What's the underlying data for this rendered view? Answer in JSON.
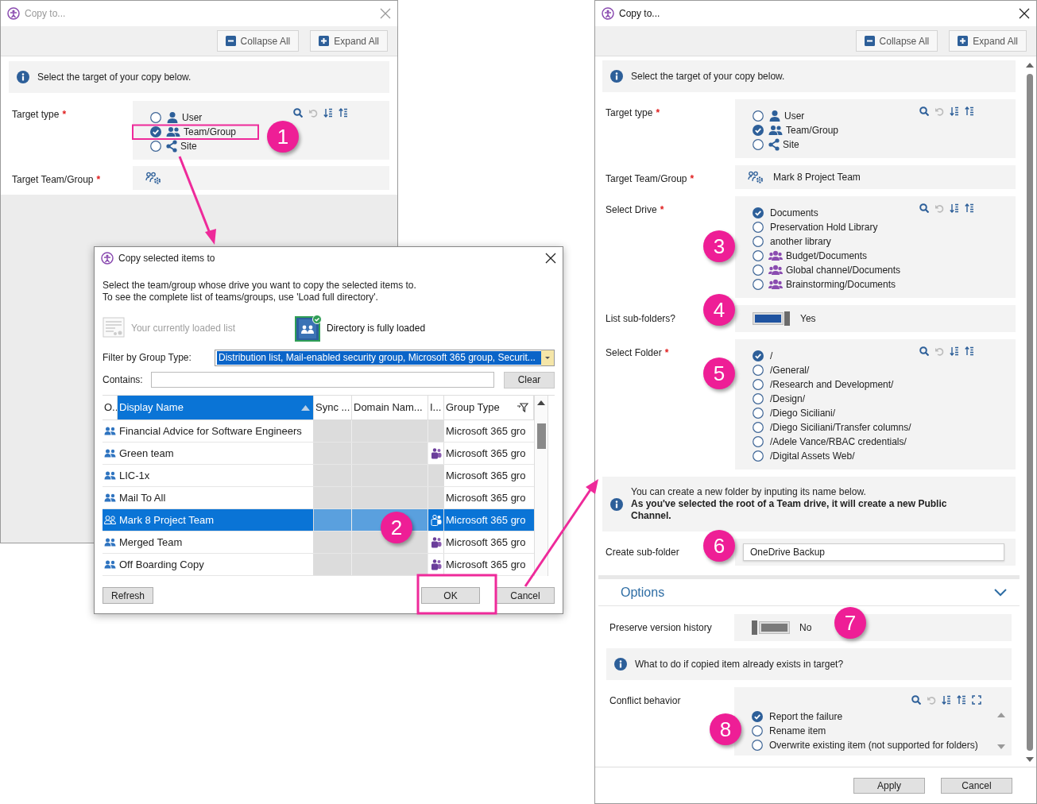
{
  "back_window": {
    "title": "Copy to...",
    "toolbar_buttons": [
      {
        "label": "Collapse All",
        "kind": "collapse"
      },
      {
        "label": "Expand All",
        "kind": "expand"
      }
    ],
    "info": "Select the target of your copy below.",
    "fields": [
      {
        "label": "Target type",
        "required_mark": "*",
        "kind": "radio",
        "options": [
          {
            "label": "User",
            "kind": "user",
            "selected": false
          },
          {
            "label": "Team/Group",
            "kind": "team",
            "selected": true
          },
          {
            "label": "Site",
            "kind": "site",
            "selected": false
          }
        ]
      },
      {
        "label": "Target Team/Group",
        "required_mark": "*",
        "kind": "picker"
      }
    ]
  },
  "dialog": {
    "title": "Copy selected items to",
    "description": "Select the team/group whose drive you want to copy the selected items to.\nTo see the complete list of teams/groups, use 'Load full directory'.",
    "sources": [
      {
        "label": "Your currently loaded list",
        "kind": "list",
        "selected": false
      },
      {
        "label": "Directory is fully loaded",
        "kind": "directory",
        "selected": true
      }
    ],
    "filter_label": "Filter by Group Type:",
    "filter_value": "Distribution list, Mail-enabled security group, Microsoft 365 group, Securit...",
    "contains_label": "Contains:",
    "clear_button": "Clear",
    "table": {
      "columns": [
        "O..",
        "Display Name",
        "Sync ...",
        "Domain Nam...",
        "I...",
        "Group Type"
      ],
      "rows": [
        {
          "name": "Financial Advice for Software Engineers",
          "teams": false,
          "group_type": "Microsoft 365 gro",
          "selected": false
        },
        {
          "name": "Green team",
          "teams": true,
          "group_type": "Microsoft 365 gro",
          "selected": false
        },
        {
          "name": "LIC-1x",
          "teams": false,
          "group_type": "Microsoft 365 gro",
          "selected": false
        },
        {
          "name": "Mail To All",
          "teams": false,
          "group_type": "Microsoft 365 gro",
          "selected": false
        },
        {
          "name": "Mark 8 Project Team",
          "teams": true,
          "group_type": "Microsoft 365 gro",
          "selected": true
        },
        {
          "name": "Merged Team",
          "teams": true,
          "group_type": "Microsoft 365 gro",
          "selected": false
        },
        {
          "name": "Off Boarding Copy",
          "teams": true,
          "group_type": "Microsoft 365 gro",
          "selected": false
        }
      ]
    },
    "buttons": [
      "Refresh",
      "OK",
      "Cancel"
    ]
  },
  "front_window": {
    "title": "Copy to...",
    "toolbar_buttons": [
      {
        "label": "Collapse All",
        "kind": "collapse"
      },
      {
        "label": "Expand All",
        "kind": "expand"
      }
    ],
    "info": "Select the target of your copy below.",
    "fields": [
      {
        "label": "Target type",
        "required_mark": "*",
        "kind": "radio",
        "options": [
          {
            "label": "User",
            "kind": "user",
            "selected": false
          },
          {
            "label": "Team/Group",
            "kind": "team",
            "selected": true
          },
          {
            "label": "Site",
            "kind": "site",
            "selected": false
          }
        ]
      },
      {
        "label": "Target Team/Group",
        "required_mark": "*",
        "kind": "picker",
        "value": "Mark 8 Project Team"
      },
      {
        "label": "Select Drive",
        "required_mark": "*",
        "kind": "radio",
        "options": [
          {
            "label": "Documents",
            "selected": true
          },
          {
            "label": "Preservation Hold Library",
            "selected": false
          },
          {
            "label": "another library",
            "selected": false
          },
          {
            "label": "Budget/Documents",
            "kind": "channel",
            "selected": false
          },
          {
            "label": "Global channel/Documents",
            "kind": "channel",
            "selected": false
          },
          {
            "label": "Brainstorming/Documents",
            "kind": "channel",
            "selected": false
          }
        ]
      },
      {
        "label": "List sub-folders?",
        "kind": "toggle",
        "on": true,
        "text": "Yes"
      },
      {
        "label": "Select Folder",
        "required_mark": "*",
        "kind": "radio",
        "options": [
          {
            "label": "/",
            "selected": true
          },
          {
            "label": "/General/",
            "selected": false
          },
          {
            "label": "/Research and Development/",
            "selected": false
          },
          {
            "label": "/Design/",
            "selected": false
          },
          {
            "label": "/Diego Siciliani/",
            "selected": false
          },
          {
            "label": "/Diego Siciliani/Transfer columns/",
            "selected": false
          },
          {
            "label": "/Adele Vance/RBAC credentials/",
            "selected": false
          },
          {
            "label": "/Digital Assets Web/",
            "selected": false
          }
        ]
      },
      {
        "kind": "info",
        "text": "You can create a new folder by inputing its name below.\n**As you've selected the root of a Team drive, it will create a new Public Channel.**"
      },
      {
        "label": "Create sub-folder",
        "kind": "text",
        "value": "OneDrive Backup"
      }
    ],
    "options": {
      "title": "Options",
      "expanded": true,
      "fields": [
        {
          "label": "Preserve version history",
          "kind": "toggle",
          "on": false,
          "text": "No"
        },
        {
          "kind": "info",
          "text": "What to do if copied item already exists in target?"
        },
        {
          "label": "Conflict behavior",
          "kind": "scroll_radio",
          "options": [
            {
              "label": "Report the failure",
              "selected": true
            },
            {
              "label": "Rename item",
              "selected": false
            },
            {
              "label": "Overwrite existing item (not supported for folders)",
              "selected": false
            }
          ]
        }
      ]
    },
    "footer_buttons": [
      "Apply",
      "Cancel"
    ]
  },
  "annotations": [
    {
      "label": "1"
    },
    {
      "label": "2"
    },
    {
      "label": "3"
    },
    {
      "label": "4"
    },
    {
      "label": "5"
    },
    {
      "label": "6"
    },
    {
      "label": "7"
    },
    {
      "label": "8"
    }
  ]
}
